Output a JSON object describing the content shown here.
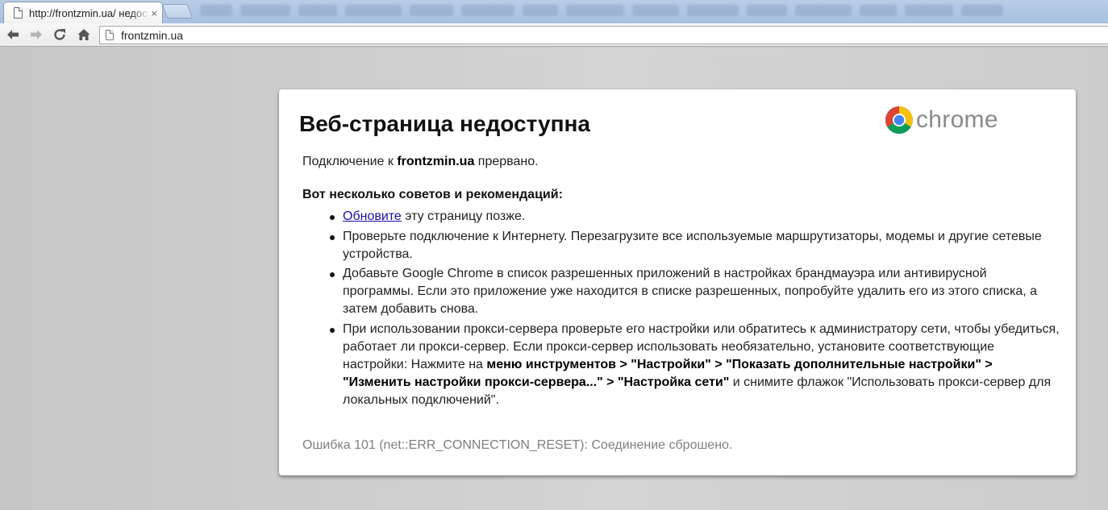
{
  "tab": {
    "title": "http://frontzmin.ua/ недоступна",
    "close": "×"
  },
  "omnibox": {
    "url": "frontzmin.ua"
  },
  "icons": {
    "back": "back-arrow-icon",
    "forward": "forward-arrow-icon",
    "reload": "reload-icon",
    "home": "home-icon",
    "page": "page-icon",
    "brand_logo": "chrome-logo-icon"
  },
  "error": {
    "title": "Веб-страница недоступна",
    "brand": "chrome",
    "intro_prefix": "Подключение к ",
    "intro_host": "frontzmin.ua",
    "intro_suffix": " прервано.",
    "tips_heading": "Вот несколько советов и рекомендаций:",
    "tip1_link": "Обновите",
    "tip1_rest": " эту страницу позже.",
    "tip2": "Проверьте подключение к Интернету. Перезагрузите все используемые маршрутизаторы, модемы и другие сетевые устройства.",
    "tip3": "Добавьте Google Chrome в список разрешенных приложений в настройках брандмауэра или антивирусной программы. Если это приложение уже находится в списке разрешенных, попробуйте удалить его из этого списка, а затем добавить снова.",
    "tip4_part1": "При использовании прокси-сервера проверьте его настройки или обратитесь к администратору сети, чтобы убедиться, работает ли прокси-сервер. Если прокси-сервер использовать необязательно, установите соответствующие настройки: Нажмите на ",
    "tip4_bold": "меню инструментов > \"Настройки\" > \"Показать дополнительные настройки\" > \"Изменить настройки прокси-сервера...\" > \"Настройка сети\"",
    "tip4_part2": " и снимите флажок \"Использовать прокси-сервер для локальных подключений\".",
    "code": "Ошибка 101 (net::ERR_CONNECTION_RESET): Соединение сброшено."
  },
  "colors": {
    "link": "#1a0dab",
    "muted": "#7f7f7f",
    "chrome_red": "#db4437",
    "chrome_yellow": "#f4c20d",
    "chrome_green": "#0f9d58",
    "chrome_blue": "#4285f4"
  }
}
